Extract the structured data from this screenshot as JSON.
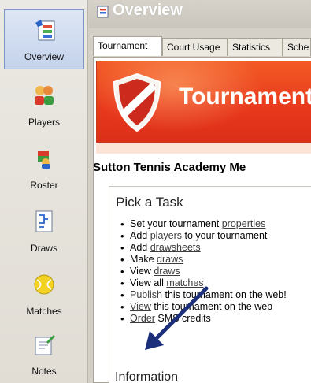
{
  "sidebar": {
    "items": [
      {
        "label": "Overview",
        "icon": "overview-icon"
      },
      {
        "label": "Players",
        "icon": "players-icon"
      },
      {
        "label": "Roster",
        "icon": "roster-icon"
      },
      {
        "label": "Draws",
        "icon": "draws-icon"
      },
      {
        "label": "Matches",
        "icon": "matches-icon"
      },
      {
        "label": "Notes",
        "icon": "notes-icon"
      }
    ]
  },
  "header": {
    "title": "Overview"
  },
  "tabs": [
    "Tournament",
    "Court Usage",
    "Statistics",
    "Sche"
  ],
  "banner": {
    "title": "Tournament"
  },
  "academy_title": "Sutton Tennis Academy Me",
  "task": {
    "heading": "Pick a Task",
    "items": [
      {
        "pre": "Set your tournament ",
        "link": "properties",
        "post": ""
      },
      {
        "pre": "Add ",
        "link": "players",
        "post": " to your tournament"
      },
      {
        "pre": "Add ",
        "link": "drawsheets",
        "post": ""
      },
      {
        "pre": "Make ",
        "link": "draws",
        "post": ""
      },
      {
        "pre": "View ",
        "link": "draws",
        "post": ""
      },
      {
        "pre": "View all ",
        "link": "matches",
        "post": ""
      },
      {
        "pre": "",
        "link": "Publish",
        "post": " this tournament on the web!"
      },
      {
        "pre": "",
        "link": "View",
        "post": " this tournament on the web"
      },
      {
        "pre": "",
        "link": "Order",
        "post": " SMS credits"
      }
    ]
  },
  "info_heading": "Information",
  "colors": {
    "banner": "#e8381c",
    "arrow": "#1c2f7a",
    "active_nav": "#c4d3ec"
  }
}
